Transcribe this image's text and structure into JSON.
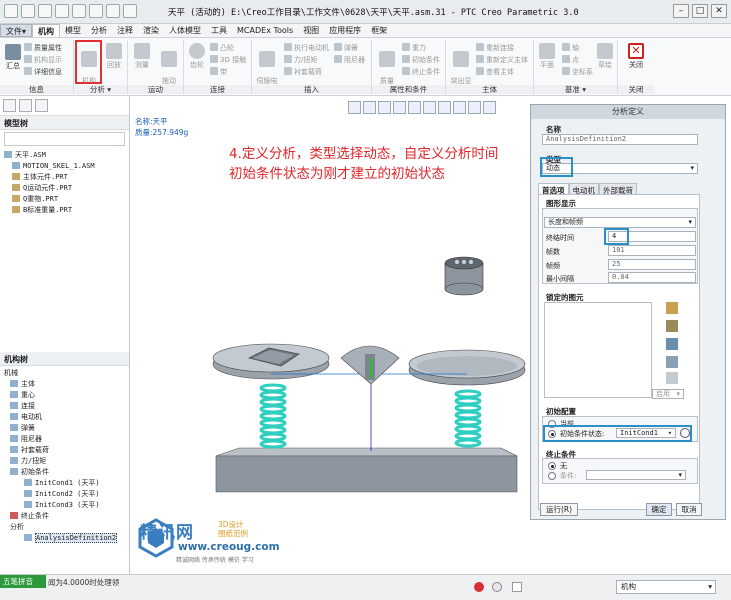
{
  "window": {
    "title": "天平 (活动的) E:\\Creo工作目录\\工作文件\\0628\\天平\\天平.asm.31 - PTC Creo Parametric 3.0"
  },
  "menu": {
    "tabs": [
      "文件▾",
      "机构",
      "模型",
      "分析",
      "注释",
      "渲染",
      "人体模型",
      "工具",
      "MCADEx Tools",
      "视图",
      "应用程序",
      "框架"
    ]
  },
  "ribbon": {
    "groups": {
      "info": "信息",
      "analysis": "分析 ▾",
      "motion": "运动",
      "connect": "连接",
      "insert": "插入",
      "props": "属性和条件",
      "body": "主体",
      "datum": "基准 ▾",
      "close": "关闭"
    },
    "buttons": {
      "summary": "汇总",
      "mass": "质量属性",
      "mech_display": "机构显示",
      "detail": "详细信息",
      "mech_analysis": "机构\n分析",
      "playback": "回放",
      "measure": "测量",
      "drag": "拖动\n元件",
      "gear": "齿轮",
      "cam": "凸轮",
      "3d_contact": "3D 接触",
      "belt": "带",
      "servo": "伺服电\n动机",
      "exec_motor": "执行电动机",
      "force": "力/扭矩",
      "spring": "弹簧",
      "damper": "阻尼器",
      "bushing": "衬套载荷",
      "mass_prop": "质量\n属性",
      "gravity": "重力",
      "init_cond": "初始条件",
      "term_cond": "终止条件",
      "highlight_body": "突出显\n示主体",
      "redefine_body": "重新定义主体",
      "reconnect": "重新连接",
      "view_body": "查看主体",
      "plane": "平面",
      "axis": "轴",
      "point": "点",
      "csys": "坐标系",
      "sketch": "草绘",
      "close": "关闭"
    }
  },
  "model_tree": {
    "title": "模型树",
    "items": [
      "天平.ASM",
      "MOTION_SKEL_1.ASM",
      "主体元件.PRT",
      "Q运动元件.PRT",
      "Q重物.PRT",
      "B标准重量.PRT"
    ]
  },
  "mech_tree": {
    "title": "机构树",
    "items": [
      "机械",
      "主体",
      "重心",
      "连接",
      "电动机",
      "弹簧",
      "阻尼器",
      "衬套载荷",
      "力/扭矩",
      "初始条件",
      "InitCond1 (天平)",
      "InitCond2 (天平)",
      "InitCond3 (天平)",
      "终止条件",
      "分析",
      "AnalysisDefinition2"
    ]
  },
  "graphics": {
    "name_line": "名称:天平",
    "mass_line": "质量:257.949g",
    "annotation_line1": "4.定义分析，类型选择动态，自定义分析时间",
    "annotation_line2": "初始条件状态为刚才建立的初始状态"
  },
  "dialog": {
    "title": "分析定义",
    "name_label": "名称",
    "name_value": "AnalysisDefinition2",
    "type_label": "类型",
    "type_value": "动态",
    "tabs": [
      "首选项",
      "电动机",
      "外部载荷"
    ],
    "graph_display_label": "图形显示",
    "mode_value": "长度和帧频",
    "end_time_label": "终结时间",
    "end_time_value": "4",
    "frames_label": "帧数",
    "frames_value": "101",
    "frame_rate_label": "帧频",
    "frame_rate_value": "25",
    "min_interval_label": "最小间隔",
    "min_interval_value": "0.04",
    "locked_label": "锁定的图元",
    "enable_label": "启用",
    "init_config_label": "初始配置",
    "current_label": "当前",
    "init_state_label": "初始条件状态:",
    "init_state_value": "InitCond1",
    "term_cond_label": "终止条件",
    "none_label": "无",
    "cond_label": "条件:",
    "run_button": "运行(R)",
    "ok_button": "确定",
    "cancel_button": "取消"
  },
  "status": {
    "task_button": "五笔拼音",
    "message": "闻为4.0000时处理领",
    "filter_value": "机构"
  },
  "watermark": {
    "brand": "精讯网",
    "sub": "3D设计\n图纸范例",
    "url": "www.creoug.com",
    "tagline": "精诚网络 传承传统 模仿 学习"
  },
  "colors": {
    "accent": "#2a8fc9",
    "annotation": "#e0262a",
    "highlight_box": "#e03030",
    "spring": "#2ecfc0"
  }
}
